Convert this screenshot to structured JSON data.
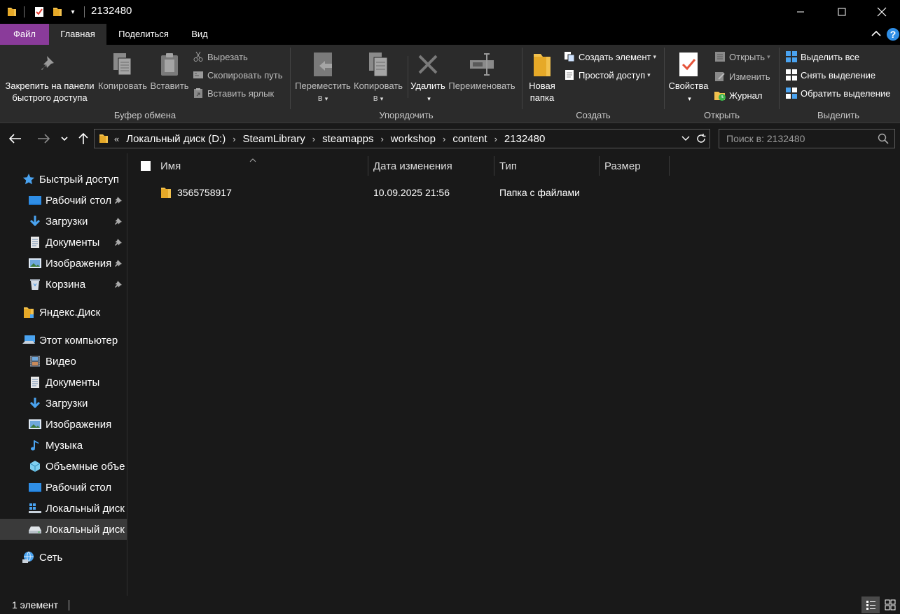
{
  "window": {
    "title": "2132480",
    "minimize_glyph": "—",
    "maximize_glyph": "☐",
    "close_glyph": "✕"
  },
  "tabs": [
    {
      "label": "Файл"
    },
    {
      "label": "Главная"
    },
    {
      "label": "Поделиться"
    },
    {
      "label": "Вид"
    }
  ],
  "ribbon": {
    "clipboard": {
      "pin_label_1": "Закрепить на панели",
      "pin_label_2": "быстрого доступа",
      "copy": "Копировать",
      "paste": "Вставить",
      "cut": "Вырезать",
      "copy_path": "Скопировать путь",
      "paste_shortcut": "Вставить ярлык",
      "group": "Буфер обмена"
    },
    "organize": {
      "move_1": "Переместить",
      "move_2": "в",
      "copy_1": "Копировать",
      "copy_2": "в",
      "delete": "Удалить",
      "rename": "Переименовать",
      "group": "Упорядочить"
    },
    "create": {
      "new_folder_1": "Новая",
      "new_folder_2": "папка",
      "new_item": "Создать элемент",
      "easy_access": "Простой доступ",
      "group": "Создать"
    },
    "open": {
      "properties": "Свойства",
      "open": "Открыть",
      "edit": "Изменить",
      "history": "Журнал",
      "group": "Открыть"
    },
    "select": {
      "select_all": "Выделить все",
      "select_none": "Снять выделение",
      "invert": "Обратить выделение",
      "group": "Выделить"
    }
  },
  "address": {
    "overflow": "«",
    "crumbs": [
      "Локальный диск (D:)",
      "SteamLibrary",
      "steamapps",
      "workshop",
      "content",
      "2132480"
    ],
    "search_placeholder": "Поиск в: 2132480"
  },
  "sidebar": {
    "items": [
      {
        "label": "Быстрый доступ",
        "icon": "star-icon"
      },
      {
        "label": "Рабочий стол",
        "icon": "desktop-icon",
        "pinned": true
      },
      {
        "label": "Загрузки",
        "icon": "download-icon",
        "pinned": true
      },
      {
        "label": "Документы",
        "icon": "documents-icon",
        "pinned": true
      },
      {
        "label": "Изображения",
        "icon": "pictures-icon",
        "pinned": true
      },
      {
        "label": "Корзина",
        "icon": "recycle-bin-icon",
        "pinned": true
      },
      {
        "label": "Яндекс.Диск",
        "icon": "yandex-disk-icon"
      },
      {
        "label": "Этот компьютер",
        "icon": "this-pc-icon"
      },
      {
        "label": "Видео",
        "icon": "video-icon"
      },
      {
        "label": "Документы",
        "icon": "documents-icon"
      },
      {
        "label": "Загрузки",
        "icon": "download-icon"
      },
      {
        "label": "Изображения",
        "icon": "pictures-icon"
      },
      {
        "label": "Музыка",
        "icon": "music-icon"
      },
      {
        "label": "Объемные объе",
        "icon": "3d-objects-icon"
      },
      {
        "label": "Рабочий стол",
        "icon": "desktop-icon"
      },
      {
        "label": "Локальный диск",
        "icon": "windows-drive-icon"
      },
      {
        "label": "Локальный диск",
        "icon": "drive-icon",
        "selected": true
      },
      {
        "label": "Сеть",
        "icon": "network-icon"
      }
    ]
  },
  "columns": [
    "Имя",
    "Дата изменения",
    "Тип",
    "Размер"
  ],
  "files": [
    {
      "name": "3565758917",
      "modified": "10.09.2025 21:56",
      "type": "Папка с файлами",
      "size": ""
    }
  ],
  "status": {
    "count": "1 элемент"
  },
  "colors": {
    "file_tab": "#8a3b9a",
    "folder": "#f2c14e",
    "accent_blue": "#2f8ee6"
  }
}
